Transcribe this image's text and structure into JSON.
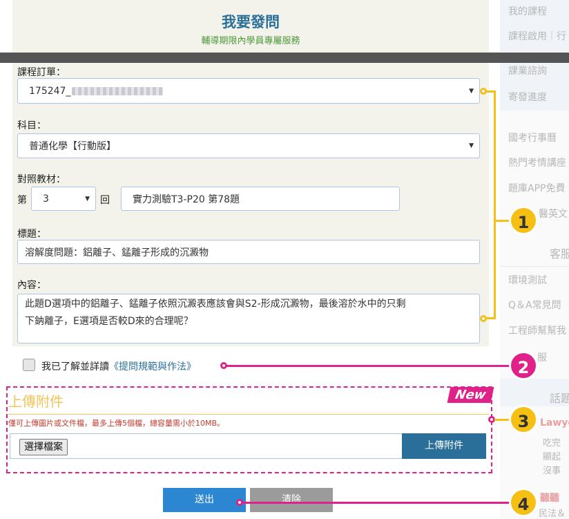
{
  "header": {
    "title": "我要發問",
    "subtitle": "輔導期限內學員專屬服務"
  },
  "form": {
    "order": {
      "label": "課程訂單：",
      "value_prefix": "175247_"
    },
    "subject": {
      "label": "科目：",
      "value": "普通化學【行動版】"
    },
    "material": {
      "label": "對照教材：",
      "prefix": "第",
      "chapter_value": "3",
      "suffix": "回",
      "ref_value": "實力測驗T3-P20 第78題"
    },
    "title": {
      "label": "標題：",
      "value": "溶解度問題：鋁離子、錳離子形成的沉澱物"
    },
    "content": {
      "label": "內容：",
      "line1": "此題D選項中的鋁離子、錳離子依照沉澱表應該會與S2-形成沉澱物，最後溶於水中的只剩",
      "line2": "下鈉離子，E選項是否較D來的合理呢？"
    },
    "agree": {
      "text": "我已了解並詳讀",
      "link": "《提問規範與作法》"
    }
  },
  "upload": {
    "tag": "New",
    "title": "上傳附件",
    "note": "僅可上傳圖片或文件檔，最多上傳5個檔，總容量需小於10MB。",
    "choose_label": "選擇檔案",
    "button_label": "上傳附件"
  },
  "actions": {
    "submit_label": "送出",
    "clear_label": "清除"
  },
  "sidebar": {
    "items": [
      "我的課程",
      "課程啟用｜行",
      "課業諮詢",
      "寄發進度",
      "國考行事曆",
      "熱門考情講座",
      "題庫APP免費",
      "醫英文",
      "客服",
      "環境測試",
      "Q＆A常見問",
      "工程師幫幫我",
      "服",
      "話題",
      "Lawye",
      "吃完",
      "顯起",
      "沒事",
      "聽聽",
      "民法＆"
    ]
  },
  "callouts": [
    "1",
    "2",
    "3",
    "4"
  ],
  "colors": {
    "accent_blue": "#2a6f9a",
    "highlight_yellow": "#f5bf14",
    "highlight_pink": "#e0218a"
  }
}
